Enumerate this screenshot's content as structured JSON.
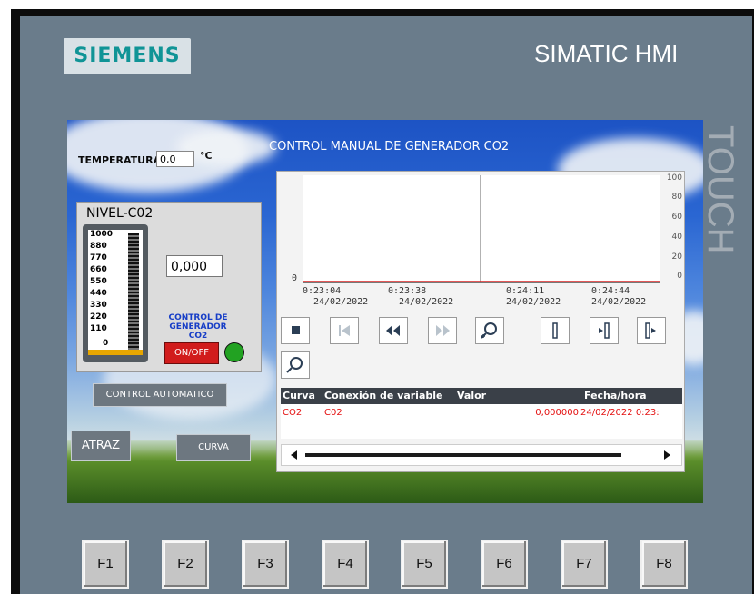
{
  "bezel": {
    "brand": "SIEMENS",
    "model": "SIMATIC HMI",
    "touch_label": "TOUCH"
  },
  "screen": {
    "title": "CONTROL MANUAL DE GENERADOR CO2",
    "temperature": {
      "label": "TEMPERATURA",
      "value": "0,0",
      "unit": "°C"
    },
    "nivel": {
      "title": "NIVEL-C02",
      "scale": [
        "1000",
        "880",
        "770",
        "660",
        "550",
        "440",
        "330",
        "220",
        "110",
        "0"
      ],
      "value": "0,000",
      "control_label": "CONTROL DE GENERADOR CO2",
      "onoff_label": "ON/OFF",
      "led_state": "on",
      "led_color": "#22a222"
    },
    "buttons": {
      "auto": "CONTROL AUTOMATICO",
      "back": "ATRAZ",
      "curve": "CURVA"
    },
    "trend": {
      "y_right_ticks": [
        "100",
        "80",
        "60",
        "40",
        "20",
        "0"
      ],
      "y_left_tick": "0",
      "x_ticks": [
        {
          "time": "0:23:04",
          "date": "24/02/2022"
        },
        {
          "time": "0:23:38",
          "date": "24/02/2022"
        },
        {
          "time": "0:24:11",
          "date": "24/02/2022"
        },
        {
          "time": "0:24:44",
          "date": "24/02/2022"
        }
      ],
      "toolbar": [
        "stop-icon",
        "first-icon",
        "rewind-icon",
        "forward-icon",
        "zoom-in-icon",
        "ruler-icon",
        "ruler-back-icon",
        "ruler-forward-icon",
        "zoom-icon"
      ],
      "legend_headers": {
        "curve": "Curva",
        "connection": "Conexión de variable",
        "value": "Valor",
        "datetime": "Fecha/hora"
      },
      "legend_rows": [
        {
          "curve": "CO2",
          "connection": "C02",
          "value": "0,000000",
          "datetime": "24/02/2022 0:23:"
        }
      ],
      "line_color": "#d92020"
    }
  },
  "function_keys": [
    "F1",
    "F2",
    "F3",
    "F4",
    "F5",
    "F6",
    "F7",
    "F8"
  ],
  "colors": {
    "bezel": "#6a7c8b",
    "onoff": "#d11c1c",
    "control_text": "#173ec7",
    "legend_text": "#e41111"
  }
}
